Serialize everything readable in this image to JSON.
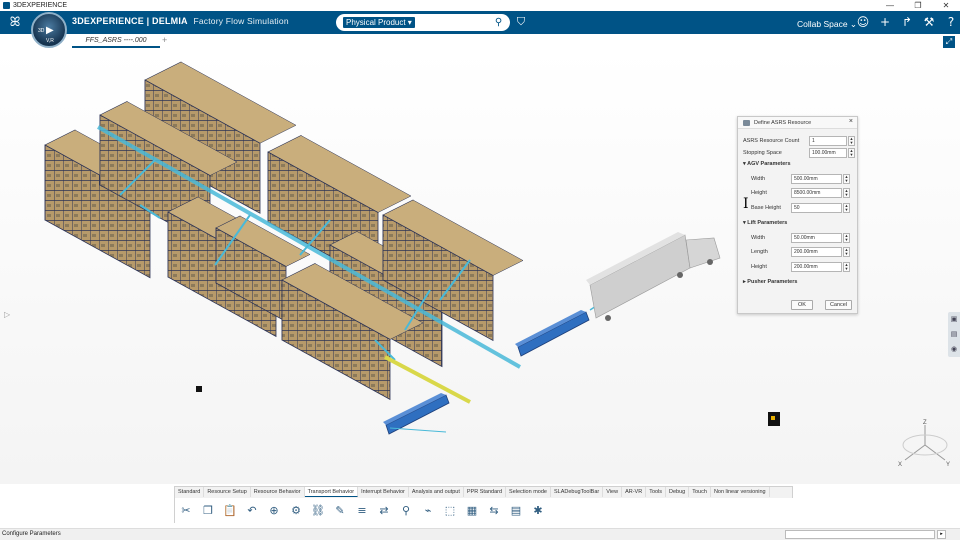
{
  "window": {
    "title": "3DEXPERIENCE",
    "controls": [
      "—",
      "❐",
      "✕"
    ]
  },
  "header": {
    "brand_bold": "3DEXPERIENCE | DELMIA",
    "brand_app": "Factory Flow Simulation",
    "search_scope": "Physical Product ▾",
    "search_placeholder": "",
    "collab_space": "Collab Space ⌄"
  },
  "compass": {
    "label": "V,R",
    "badge": "3D"
  },
  "tabs": [
    {
      "label": "FFS_ASRS ----.000"
    }
  ],
  "dialog": {
    "title": "Define ASRS Resource",
    "asrs_count_label": "ASRS Resource Count",
    "asrs_count_value": "1",
    "stopping_space_label": "Stopping Space",
    "stopping_space_value": "100.00mm",
    "agv_section": "AGV Parameters",
    "agv_width_label": "Width",
    "agv_width_value": "500.00mm",
    "agv_height_label": "Height",
    "agv_height_value": "8500.00mm",
    "agv_base_label": "Base Height",
    "agv_base_value": "50",
    "lift_section": "Lift Parameters",
    "lift_width_label": "Width",
    "lift_width_value": "50.00mm",
    "lift_length_label": "Length",
    "lift_length_value": "200.00mm",
    "lift_height_label": "Height",
    "lift_height_value": "200.00mm",
    "pusher_section": "Pusher Parameters",
    "ok_label": "OK",
    "cancel_label": "Cancel"
  },
  "action_bar": {
    "tabs": [
      "Standard",
      "Resource Setup",
      "Resource Behavior",
      "Transport Behavior",
      "Interrupt Behavior",
      "Analysis and output",
      "PPR Standard",
      "Selection mode",
      "SLADebugToolBar",
      "View",
      "AR-VR",
      "Tools",
      "Debug",
      "Touch",
      "Non linear versioning"
    ],
    "active_tab": 3,
    "icons": [
      "cut-icon",
      "copy-icon",
      "paste-icon",
      "undo-icon",
      "zoom-icon",
      "resource-icon",
      "link-icon",
      "edit-icon",
      "conveyor-icon",
      "flow-icon",
      "robot-icon",
      "arm-icon",
      "bounding-box-icon",
      "grid-icon",
      "transfer-icon",
      "document-icon",
      "settings-icon"
    ]
  },
  "axes": {
    "x": "X",
    "y": "Y",
    "z": "Z"
  },
  "status": {
    "text": "Configure Parameters"
  },
  "colors": {
    "brand": "#005386",
    "conveyor": "#2f6fc0",
    "path": "#49b9d8",
    "rail": "#d9d84a",
    "rack_frame": "#2d3456",
    "truck": "#c9c9c9"
  }
}
